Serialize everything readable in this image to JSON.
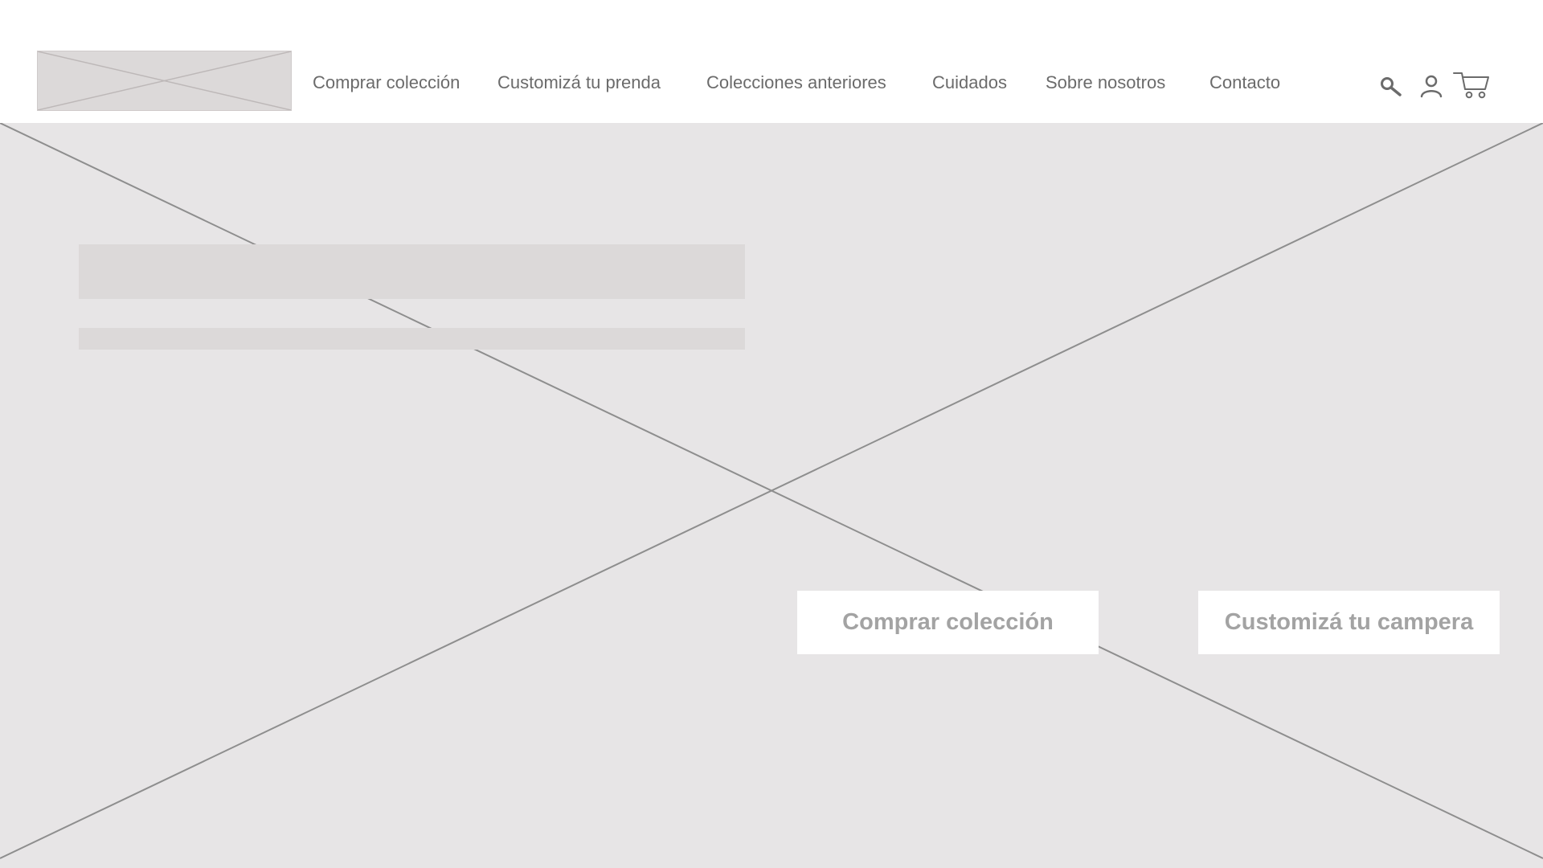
{
  "header": {
    "logo": {
      "kind": "image-placeholder"
    },
    "nav": [
      {
        "label": "Comprar colección"
      },
      {
        "label": "Customizá tu prenda"
      },
      {
        "label": "Colecciones anteriores"
      },
      {
        "label": "Cuidados"
      },
      {
        "label": "Sobre nosotros"
      },
      {
        "label": "Contacto"
      }
    ],
    "icons": [
      "search-icon",
      "user-icon",
      "cart-icon"
    ]
  },
  "hero": {
    "background": {
      "kind": "image-placeholder"
    },
    "title_placeholder": {
      "kind": "text-placeholder"
    },
    "subtitle_placeholder": {
      "kind": "text-placeholder"
    },
    "buttons": {
      "primary": "Comprar colección",
      "secondary": "Customizá tu campera"
    }
  },
  "colors": {
    "hero_bg": "#e7e5e6",
    "placeholder": "#dcd9d9",
    "nav_text": "#6b6b6b",
    "button_text": "#a3a3a3",
    "cross_line": "#8e8e8e"
  }
}
